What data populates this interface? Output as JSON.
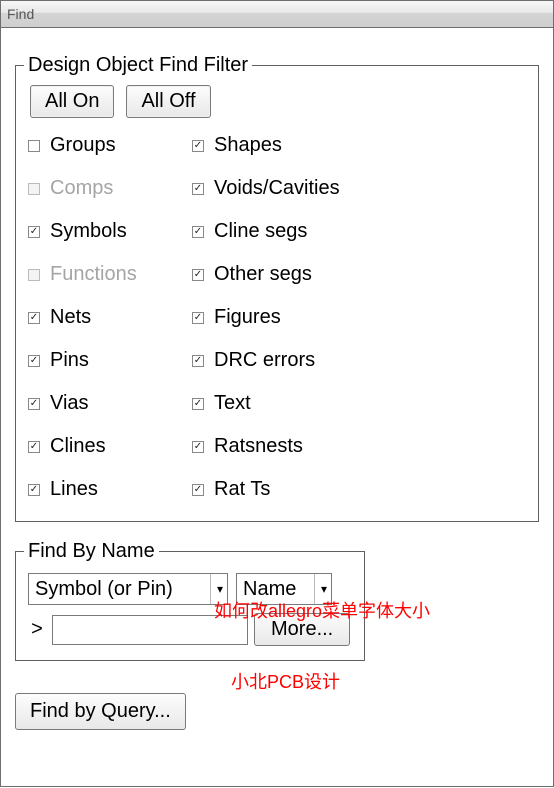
{
  "window": {
    "title": "Find"
  },
  "filter": {
    "legend": "Design Object Find Filter",
    "all_on": "All On",
    "all_off": "All Off",
    "left": [
      {
        "label": "Groups",
        "checked": false,
        "enabled": true,
        "name": "groups"
      },
      {
        "label": "Comps",
        "checked": false,
        "enabled": false,
        "name": "comps"
      },
      {
        "label": "Symbols",
        "checked": true,
        "enabled": true,
        "name": "symbols"
      },
      {
        "label": "Functions",
        "checked": false,
        "enabled": false,
        "name": "functions"
      },
      {
        "label": "Nets",
        "checked": true,
        "enabled": true,
        "name": "nets"
      },
      {
        "label": "Pins",
        "checked": true,
        "enabled": true,
        "name": "pins"
      },
      {
        "label": "Vias",
        "checked": true,
        "enabled": true,
        "name": "vias"
      },
      {
        "label": "Clines",
        "checked": true,
        "enabled": true,
        "name": "clines"
      },
      {
        "label": "Lines",
        "checked": true,
        "enabled": true,
        "name": "lines"
      }
    ],
    "right": [
      {
        "label": "Shapes",
        "checked": true,
        "enabled": true,
        "name": "shapes"
      },
      {
        "label": "Voids/Cavities",
        "checked": true,
        "enabled": true,
        "name": "voids-cavities"
      },
      {
        "label": "Cline segs",
        "checked": true,
        "enabled": true,
        "name": "cline-segs"
      },
      {
        "label": "Other segs",
        "checked": true,
        "enabled": true,
        "name": "other-segs"
      },
      {
        "label": "Figures",
        "checked": true,
        "enabled": true,
        "name": "figures"
      },
      {
        "label": "DRC errors",
        "checked": true,
        "enabled": true,
        "name": "drc-errors"
      },
      {
        "label": "Text",
        "checked": true,
        "enabled": true,
        "name": "text"
      },
      {
        "label": "Ratsnests",
        "checked": true,
        "enabled": true,
        "name": "ratsnests"
      },
      {
        "label": "Rat Ts",
        "checked": true,
        "enabled": true,
        "name": "rat-ts"
      }
    ]
  },
  "find_by_name": {
    "legend": "Find By Name",
    "type_select": "Symbol (or Pin)",
    "field_select": "Name",
    "prompt": ">",
    "input_value": "",
    "more": "More..."
  },
  "query": {
    "button": "Find by Query..."
  },
  "annotations": {
    "a1": "如何改allegro菜单字体大小",
    "a2": "小北PCB设计"
  }
}
